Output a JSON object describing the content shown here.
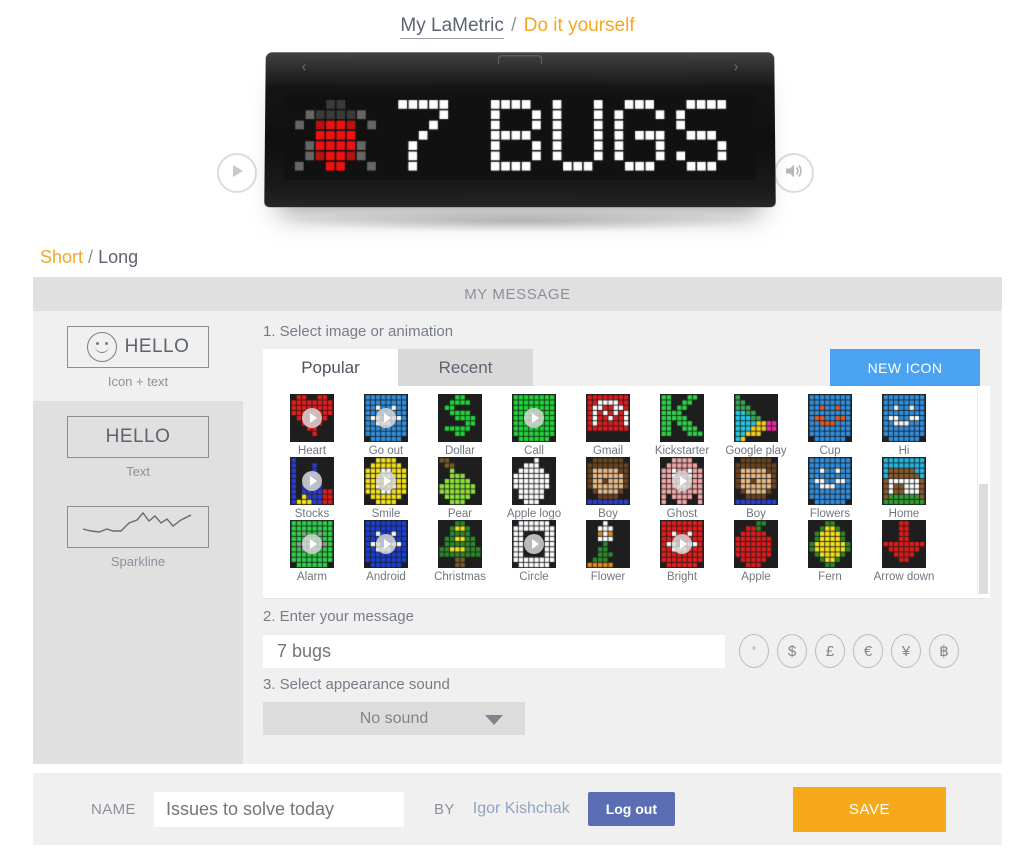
{
  "breadcrumb": {
    "root": "My LaMetric",
    "separator": "/",
    "current": "Do it yourself"
  },
  "device": {
    "play_icon": "play-icon",
    "sound_icon": "speaker-icon",
    "display_text": "7 BUGS",
    "display_icon": "ladybug-pixel-icon"
  },
  "length_tabs": {
    "short": "Short",
    "separator": "/",
    "long": "Long"
  },
  "panel": {
    "title": "MY MESSAGE"
  },
  "sidebar": {
    "items": [
      {
        "caption": "Icon + text",
        "box_text": "HELLO",
        "icon": "smiley-icon",
        "selected": true
      },
      {
        "caption": "Text",
        "box_text": "HELLO",
        "icon": "",
        "selected": false
      },
      {
        "caption": "Sparkline",
        "box_text": "",
        "icon": "sparkline-icon",
        "selected": false
      }
    ]
  },
  "steps": {
    "step1": "1. Select image or animation",
    "step2": "2. Enter your message",
    "step3": "3. Select appearance sound"
  },
  "icon_tabs": {
    "popular": "Popular",
    "recent": "Recent",
    "new_icon": "NEW ICON"
  },
  "icon_grid": [
    {
      "name": "Heart",
      "animated": true
    },
    {
      "name": "Go out",
      "animated": true
    },
    {
      "name": "Dollar",
      "animated": false
    },
    {
      "name": "Call",
      "animated": true
    },
    {
      "name": "Gmail",
      "animated": false
    },
    {
      "name": "Kickstarter",
      "animated": false
    },
    {
      "name": "Google play",
      "animated": false
    },
    {
      "name": "Cup",
      "animated": false
    },
    {
      "name": "Hi",
      "animated": false
    },
    {
      "name": "Stocks",
      "animated": true
    },
    {
      "name": "Smile",
      "animated": true
    },
    {
      "name": "Pear",
      "animated": false
    },
    {
      "name": "Apple logo",
      "animated": false
    },
    {
      "name": "Boy",
      "animated": false
    },
    {
      "name": "Ghost",
      "animated": true
    },
    {
      "name": "Boy",
      "animated": false
    },
    {
      "name": "Flowers",
      "animated": false
    },
    {
      "name": "Home",
      "animated": false
    },
    {
      "name": "Alarm",
      "animated": true
    },
    {
      "name": "Android",
      "animated": true
    },
    {
      "name": "Christmas",
      "animated": false
    },
    {
      "name": "Circle",
      "animated": true
    },
    {
      "name": "Flower",
      "animated": false
    },
    {
      "name": "Bright",
      "animated": true
    },
    {
      "name": "Apple",
      "animated": false
    },
    {
      "name": "Fern",
      "animated": false
    },
    {
      "name": "Arrow down",
      "animated": false
    }
  ],
  "message": {
    "value": "7 bugs",
    "placeholder": "7 bugs"
  },
  "currency_buttons": [
    {
      "symbol": "°",
      "name": "degree"
    },
    {
      "symbol": "$",
      "name": "dollar"
    },
    {
      "symbol": "£",
      "name": "pound"
    },
    {
      "symbol": "€",
      "name": "euro"
    },
    {
      "symbol": "¥",
      "name": "yen"
    },
    {
      "symbol": "฿",
      "name": "bitcoin"
    }
  ],
  "sound_select": {
    "value": "No sound"
  },
  "bottom": {
    "name_label": "NAME",
    "name_value": "Issues to solve today",
    "name_placeholder": "Issues to solve today",
    "by_label": "BY",
    "author": "Igor Kishchak",
    "logout": "Log out",
    "save": "SAVE"
  },
  "colors": {
    "accent_orange": "#f5a623",
    "save_orange": "#f5a91b",
    "blue_button": "#4aa3f0",
    "logout_blue": "#5b6eb4",
    "panel_gray": "#e0e0e0",
    "content_gray": "#f0f0f0"
  }
}
